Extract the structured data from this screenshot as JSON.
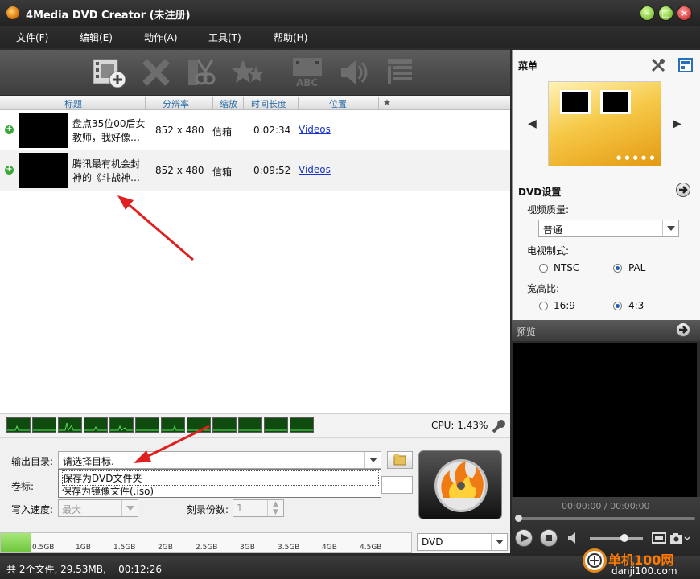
{
  "window": {
    "title": "4Media DVD Creator (未注册)"
  },
  "menu": [
    "文件(F)",
    "编辑(E)",
    "动作(A)",
    "工具(T)",
    "帮助(H)"
  ],
  "toolbar": {
    "icons": [
      "add-video-icon",
      "delete-icon",
      "clip-icon",
      "effect-icon",
      "subtitle-icon",
      "audio-icon",
      "chapter-icon"
    ]
  },
  "columns": {
    "title": "标题",
    "resolution": "分辨率",
    "zoom": "缩放",
    "duration": "时间长度",
    "location": "位置",
    "star": "★"
  },
  "files": [
    {
      "title": "盘点35位00后女教师，我好像…",
      "resolution": "852 x 480",
      "zoom": "信箱",
      "duration": "0:02:34",
      "location": "Videos"
    },
    {
      "title": "腾讯最有机会封神的《斗战神…",
      "resolution": "852 x 480",
      "zoom": "信箱",
      "duration": "0:09:52",
      "location": "Videos"
    }
  ],
  "cpu": {
    "label": "CPU: 1.43%"
  },
  "settings": {
    "output_label": "输出目录:",
    "output_value": "请选择目标.",
    "options": [
      "保存为DVD文件夹",
      "保存为镜像文件(.iso)"
    ],
    "volume_label": "卷标:",
    "speed_label": "写入速度:",
    "speed_value": "最大",
    "copies_label": "刻录份数:",
    "copies_value": "1"
  },
  "capacity": {
    "ticks": [
      "0.5GB",
      "1GB",
      "1.5GB",
      "2GB",
      "2.5GB",
      "3GB",
      "3.5GB",
      "4GB",
      "4.5GB"
    ],
    "disc_type": "DVD"
  },
  "status": {
    "text": "共 2个文件, 29.53MB,    00:12:26"
  },
  "right": {
    "menu_title": "菜单",
    "dvd_settings_title": "DVD设置",
    "video_quality_label": "视频质量:",
    "video_quality_value": "普通",
    "tv_standard_label": "电视制式:",
    "ntsc": "NTSC",
    "pal": "PAL",
    "aspect_label": "宽高比:",
    "ratio_169": "16:9",
    "ratio_43": "4:3",
    "preview_title": "预览",
    "time": "00:00:00 / 00:00:00"
  },
  "watermark": {
    "text": "单机100网",
    "url": "danji100.com"
  }
}
